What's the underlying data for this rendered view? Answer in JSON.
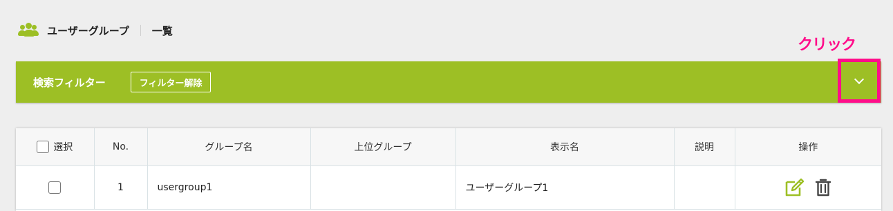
{
  "header": {
    "icon": "users-icon",
    "title": "ユーザーグループ",
    "subtitle": "一覧"
  },
  "annotation": {
    "click_label": "クリック",
    "color": "#ff0d8a"
  },
  "filter": {
    "title": "検索フィルター",
    "clear_label": "フィルター解除",
    "toggle_icon": "chevron-down-icon",
    "bar_color": "#9dbf25"
  },
  "table": {
    "columns": {
      "select": "選択",
      "no": "No.",
      "group_name": "グループ名",
      "parent_group": "上位グループ",
      "display_name": "表示名",
      "description": "説明",
      "actions": "操作"
    },
    "rows": [
      {
        "no": "1",
        "group_name": "usergroup1",
        "parent_group": "",
        "display_name": "ユーザーグループ1",
        "description": "",
        "action_icons": [
          "edit-icon",
          "trash-icon"
        ]
      }
    ]
  }
}
